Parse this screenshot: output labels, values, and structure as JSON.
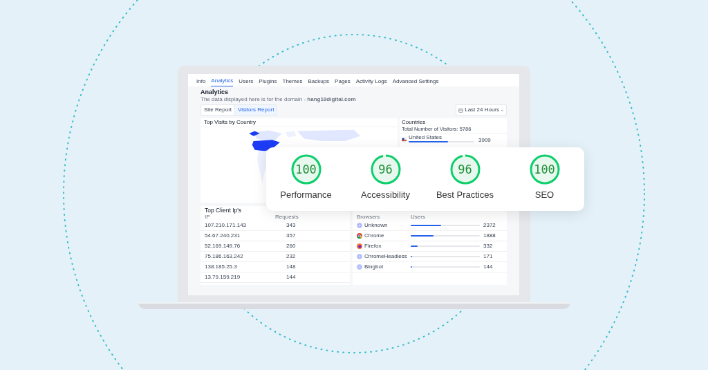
{
  "tabs": [
    {
      "label": "Info",
      "selected": false
    },
    {
      "label": "Analytics",
      "selected": true
    },
    {
      "label": "Users",
      "selected": false
    },
    {
      "label": "Plugins",
      "selected": false
    },
    {
      "label": "Themes",
      "selected": false
    },
    {
      "label": "Backups",
      "selected": false
    },
    {
      "label": "Pages",
      "selected": false
    },
    {
      "label": "Activity Logs",
      "selected": false
    },
    {
      "label": "Advanced Settings",
      "selected": false
    }
  ],
  "header": {
    "title": "Analytics",
    "subtitle": "The data displayed here is for the domain - **hang19digital.com**"
  },
  "report_buttons": [
    {
      "label": "Site Report",
      "selected": false
    },
    {
      "label": "Visitors Report",
      "selected": true
    }
  ],
  "range": {
    "label": "Last 24 Hours"
  },
  "map_card": {
    "title": "Top Visits by Country"
  },
  "countries": {
    "title": "Countries",
    "total": "Total Number of Visitors: 5786",
    "rows": [
      {
        "name": "United States",
        "level": 0.6,
        "value": "3909"
      }
    ]
  },
  "ips": {
    "title": "Top Client Ip's",
    "columns": [
      "IP",
      "Requests"
    ],
    "rows": [
      {
        "ip": "107.210.171.143",
        "requests": "343"
      },
      {
        "ip": "54.67.240.231",
        "requests": "357"
      },
      {
        "ip": "52.169.149.76",
        "requests": "260"
      },
      {
        "ip": "75.186.163.242",
        "requests": "232"
      },
      {
        "ip": "138.185.25.3",
        "requests": "148"
      },
      {
        "ip": "13.79.159.219",
        "requests": "144"
      }
    ]
  },
  "browsers": {
    "columns": [
      "Browsers",
      "Users"
    ],
    "rows": [
      {
        "name": "Unknown",
        "kind": "generic",
        "level": 0.44,
        "value": "2372"
      },
      {
        "name": "Chrome",
        "kind": "chrome",
        "level": 0.33,
        "value": "1888"
      },
      {
        "name": "Firefox",
        "kind": "firefox",
        "level": 0.1,
        "value": "332"
      },
      {
        "name": "ChromeHeadless",
        "kind": "generic",
        "level": 0.02,
        "value": "171"
      },
      {
        "name": "Bingbot",
        "kind": "generic",
        "level": 0.02,
        "value": "144"
      }
    ]
  },
  "scores": [
    {
      "value": "100",
      "label": "Performance"
    },
    {
      "value": "96",
      "label": "Accessibility"
    },
    {
      "value": "96",
      "label": "Best Practices"
    },
    {
      "value": "100",
      "label": "SEO"
    }
  ]
}
